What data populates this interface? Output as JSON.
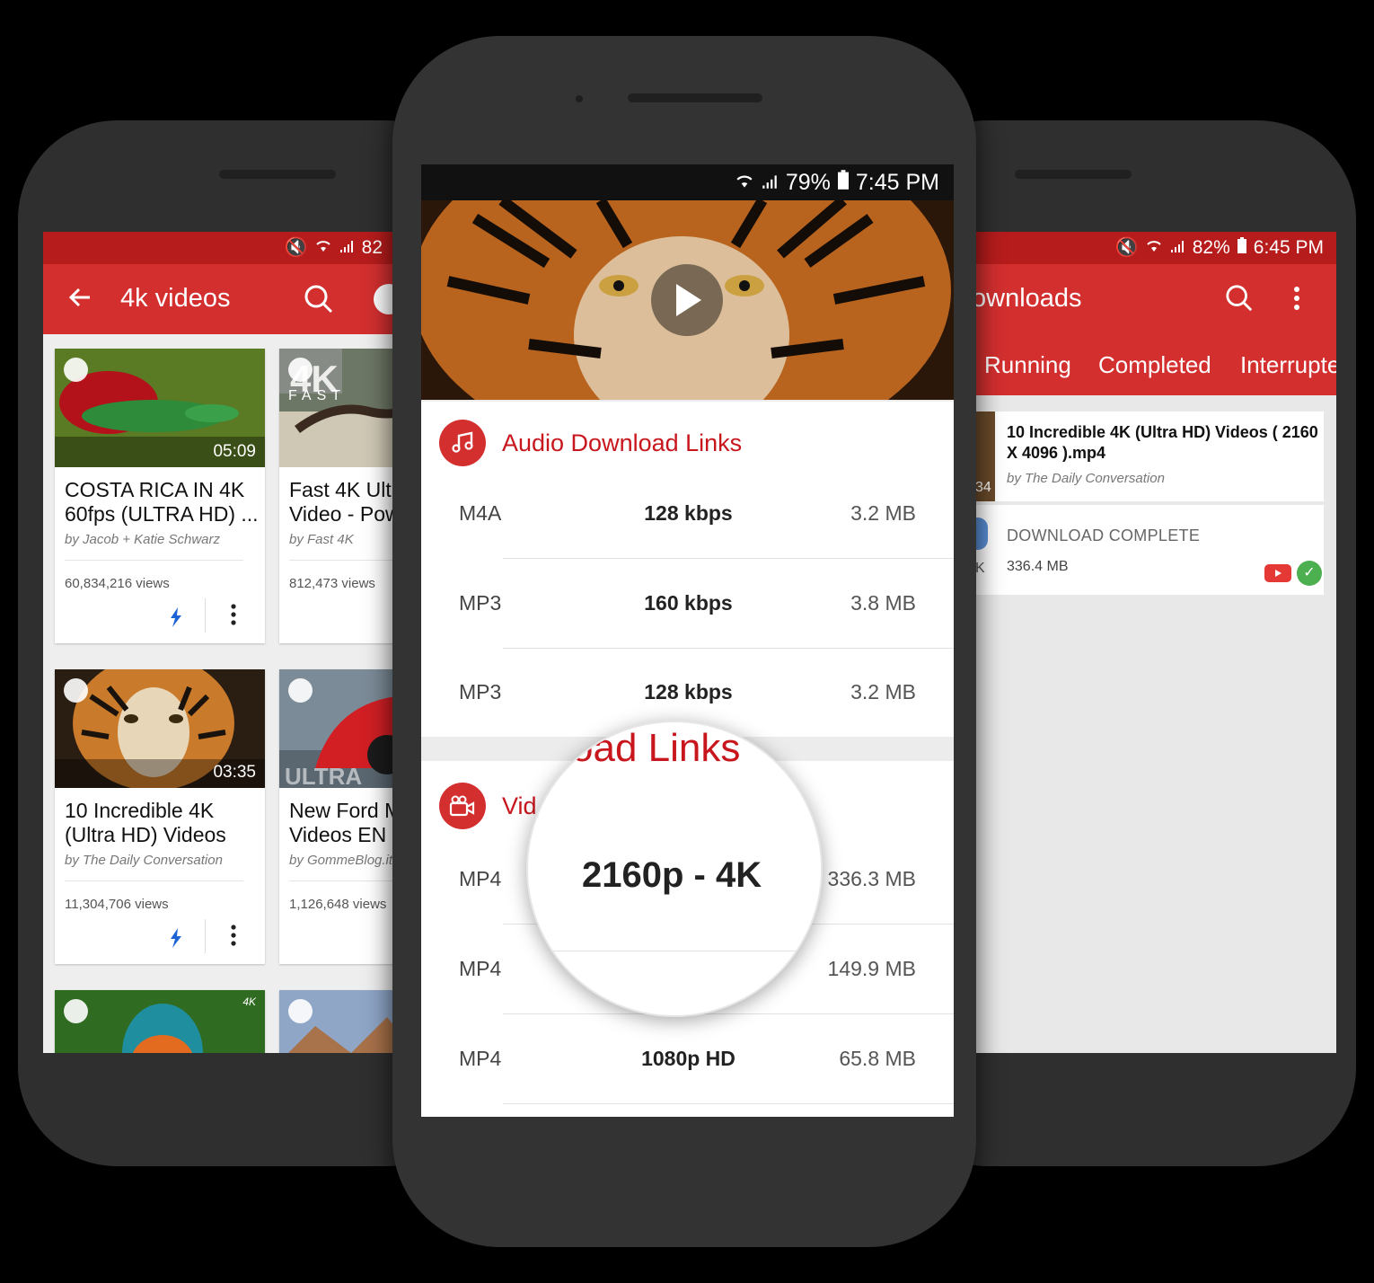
{
  "left_phone": {
    "status": {
      "battery_partial": "82"
    },
    "appbar": {
      "title": "4k videos"
    },
    "cards": [
      {
        "title_line1": "COSTA RICA IN 4K",
        "title_line2": "60fps (ULTRA HD) ...",
        "channel": "by Jacob + Katie Schwarz",
        "views": "60,834,216 views",
        "duration": "05:09"
      },
      {
        "title_line1": "Fast 4K Ultr",
        "title_line2": "Video - Pow",
        "channel": "by Fast 4K",
        "views": "812,473 views",
        "duration": ""
      },
      {
        "title_line1": "10 Incredible 4K",
        "title_line2": "(Ultra HD) Videos",
        "channel": "by The Daily Conversation",
        "views": "11,304,706 views",
        "duration": "03:35"
      },
      {
        "title_line1": "New Ford M",
        "title_line2": "Videos EN 4",
        "channel": "by GommeBlog.it",
        "views": "1,126,648 views",
        "duration": ""
      }
    ],
    "thumb_overlays": {
      "fast": "FAST",
      "ultra": "ULTRA",
      "small4k": "4K"
    }
  },
  "center_phone": {
    "status": {
      "battery": "79%",
      "time": "7:45 PM"
    },
    "audio_section": {
      "title": "Audio Download Links",
      "rows": [
        {
          "format": "M4A",
          "quality": "128 kbps",
          "size": "3.2 MB"
        },
        {
          "format": "MP3",
          "quality": "160 kbps",
          "size": "3.8 MB"
        },
        {
          "format": "MP3",
          "quality": "128 kbps",
          "size": "3.2 MB"
        }
      ]
    },
    "video_section": {
      "title_visible": "Vid",
      "rows": [
        {
          "format": "MP4",
          "quality": "",
          "size": "336.3 MB"
        },
        {
          "format": "MP4",
          "quality": "",
          "size": "149.9 MB"
        },
        {
          "format": "MP4",
          "quality": "1080p HD",
          "size": "65.8 MB"
        }
      ]
    },
    "magnifier": {
      "title_fragment": "oad Links",
      "quality": "2160p - 4K"
    }
  },
  "right_phone": {
    "status": {
      "battery": "82%",
      "time": "6:45 PM"
    },
    "appbar": {
      "title": "ownloads"
    },
    "tabs": [
      "Running",
      "Completed",
      "Interrupte"
    ],
    "download": {
      "title": "10 Incredible 4K (Ultra HD) Videos ( 2160 X 4096 ).mp4",
      "channel": "by The Daily Conversation",
      "status": "DOWNLOAD COMPLETE",
      "size": "336.4 MB",
      "thumb_fragment": "34",
      "side_fragment": "K"
    }
  }
}
